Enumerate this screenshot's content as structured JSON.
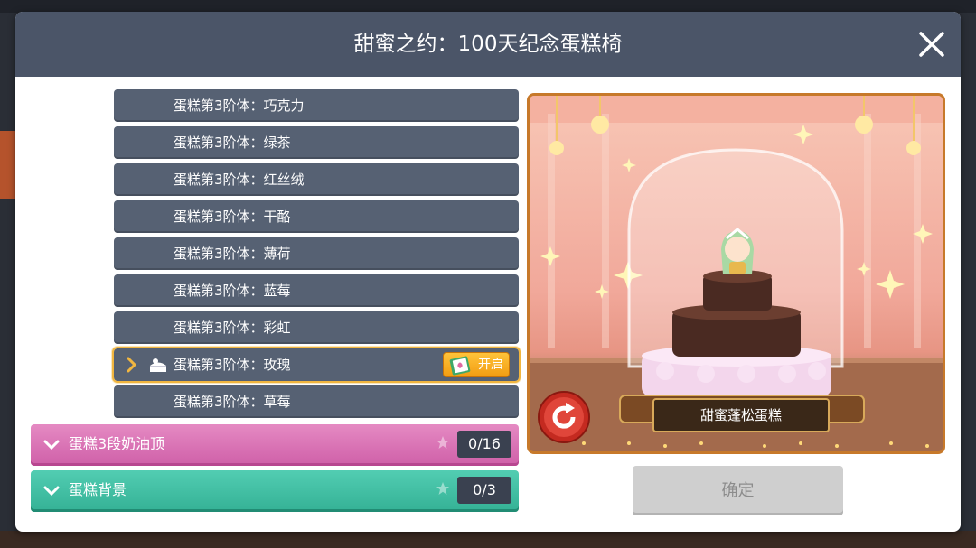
{
  "dialog": {
    "title": "甜蜜之约：100天纪念蛋糕椅"
  },
  "list": {
    "rows": [
      {
        "label": "蛋糕第3阶体：巧克力"
      },
      {
        "label": "蛋糕第3阶体：绿茶"
      },
      {
        "label": "蛋糕第3阶体：红丝绒"
      },
      {
        "label": "蛋糕第3阶体：干酪"
      },
      {
        "label": "蛋糕第3阶体：薄荷"
      },
      {
        "label": "蛋糕第3阶体：蓝莓"
      },
      {
        "label": "蛋糕第3阶体：彩虹"
      },
      {
        "label": "蛋糕第3阶体：玫瑰",
        "selected": true,
        "badge": "开启"
      },
      {
        "label": "蛋糕第3阶体：草莓"
      }
    ],
    "categories": [
      {
        "label": "蛋糕3段奶油顶",
        "count": "0/16",
        "color": "#d96cb4"
      },
      {
        "label": "蛋糕背景",
        "count": "0/3",
        "color": "#3dbd9f"
      }
    ]
  },
  "preview": {
    "item_name": "甜蜜蓬松蛋糕"
  },
  "actions": {
    "confirm_label": "确定"
  },
  "icons": [
    "close-icon",
    "chevron-right-icon",
    "cake-icon",
    "book-icon",
    "chevron-down-icon",
    "star-icon",
    "refresh-icon",
    "sparkle-icon"
  ]
}
